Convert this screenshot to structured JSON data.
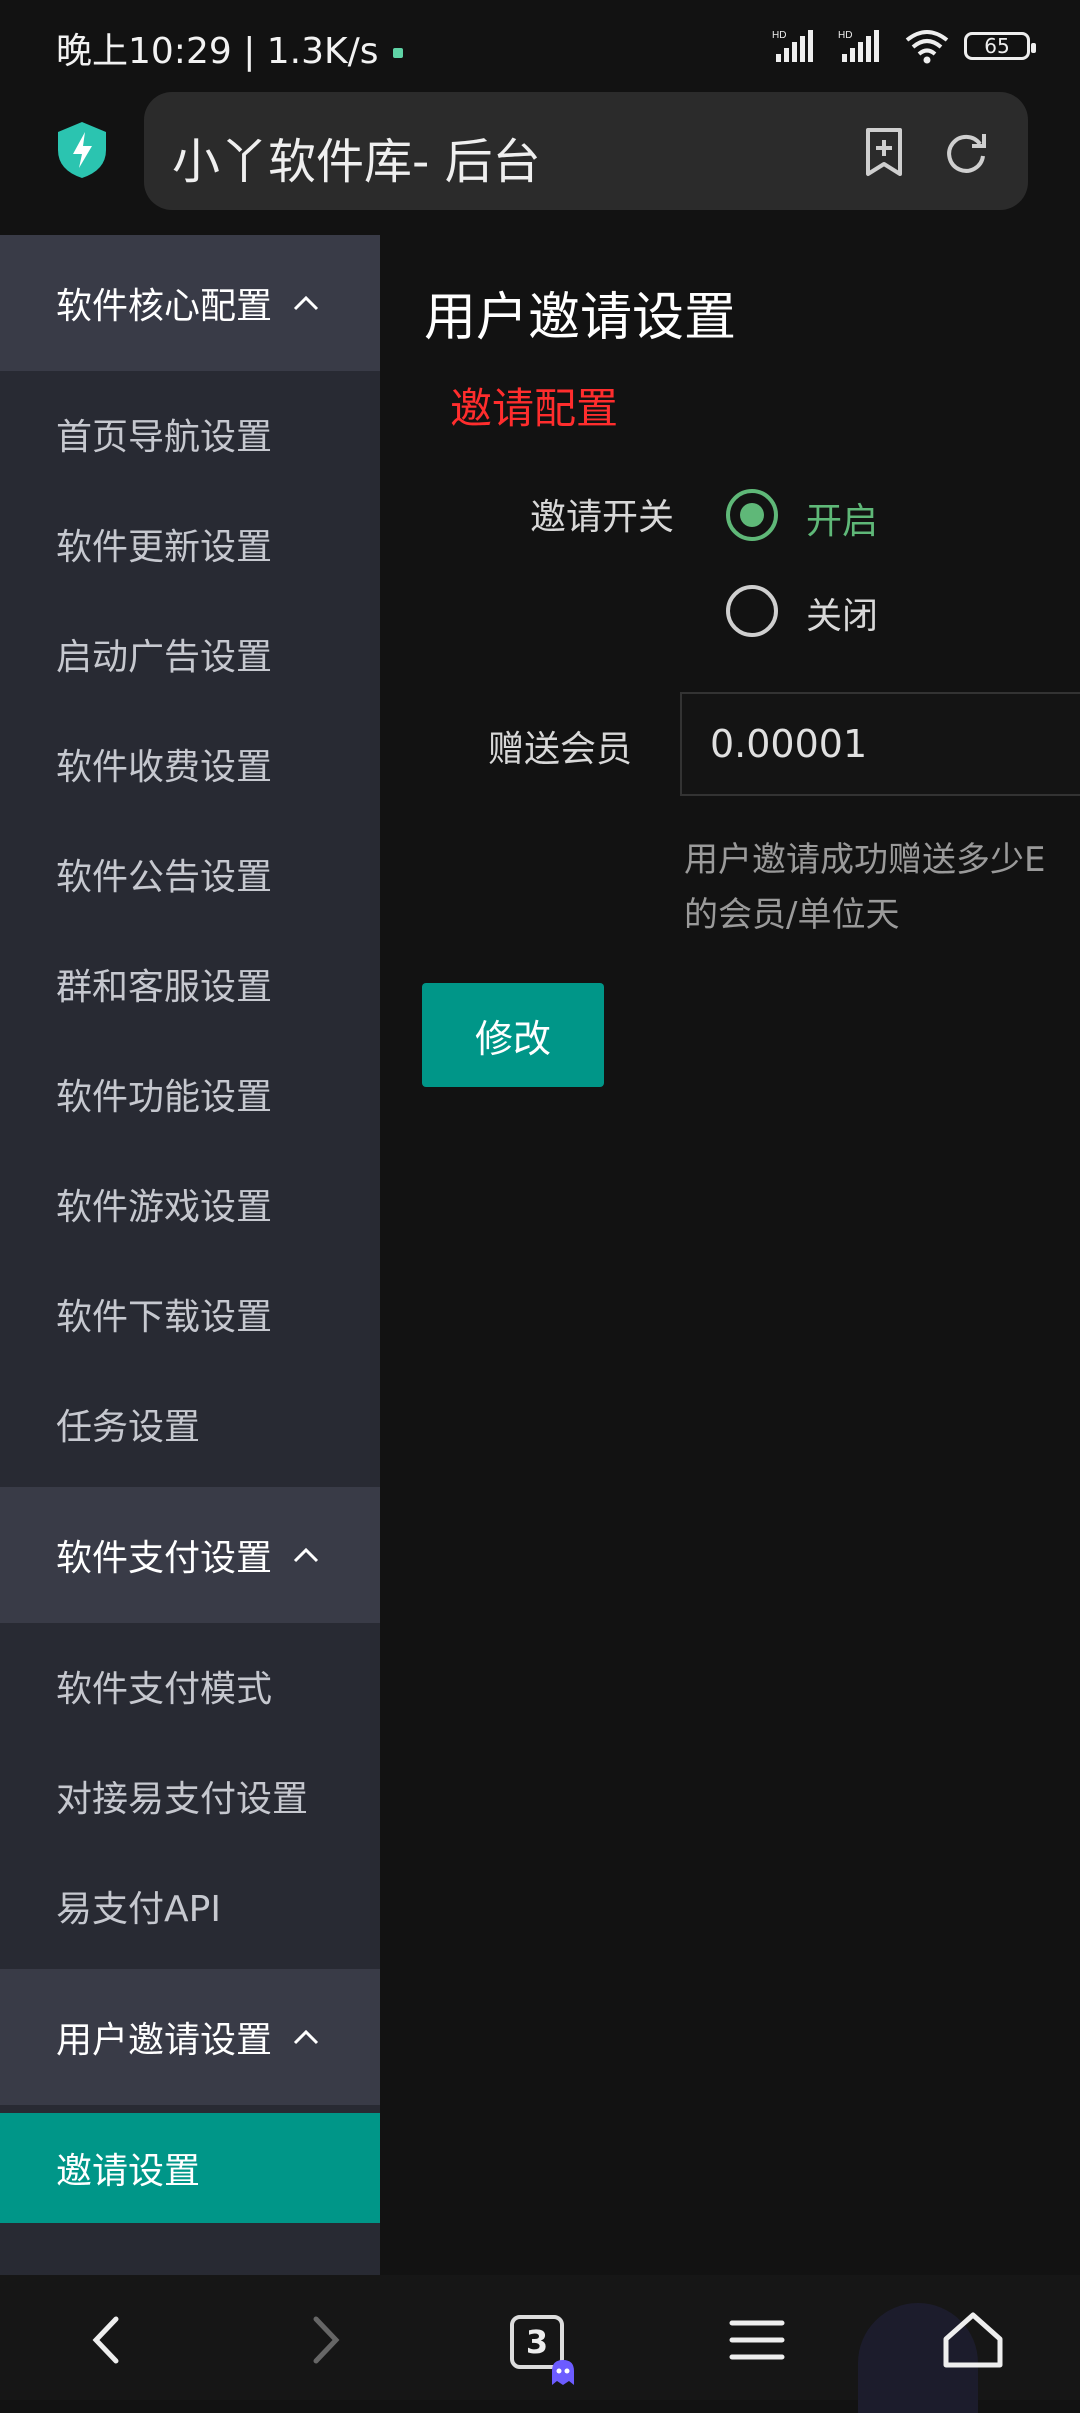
{
  "status": {
    "time_speed": "晚上10:29 | 1.3K/s",
    "battery": "65",
    "signal1_label": "HD",
    "signal2_label": "HD"
  },
  "browser": {
    "url_title": "小丫软件库- 后台",
    "tab_count": "3"
  },
  "sidebar": {
    "groups": [
      {
        "title": "软件核心配置",
        "items": [
          "首页导航设置",
          "软件更新设置",
          "启动广告设置",
          "软件收费设置",
          "软件公告设置",
          "群和客服设置",
          "软件功能设置",
          "软件游戏设置",
          "软件下载设置",
          "任务设置"
        ]
      },
      {
        "title": "软件支付设置",
        "items": [
          "软件支付模式",
          "对接易支付设置",
          "易支付API"
        ]
      },
      {
        "title": "用户邀请设置",
        "items": [
          "邀请设置"
        ]
      }
    ]
  },
  "main": {
    "page_title": "用户邀请设置",
    "section_title": "邀请配置",
    "switch_label": "邀请开关",
    "radio_on_label": "开启",
    "radio_off_label": "关闭",
    "gift_label": "赠送会员",
    "gift_value": "0.00001",
    "help_line1": "用户邀请成功赠送多少E",
    "help_line2": "的会员/单位天",
    "submit_label": "修改"
  },
  "colors": {
    "accent": "#009688",
    "section_title": "#ff2d2d",
    "radio_on": "#5fb878"
  }
}
